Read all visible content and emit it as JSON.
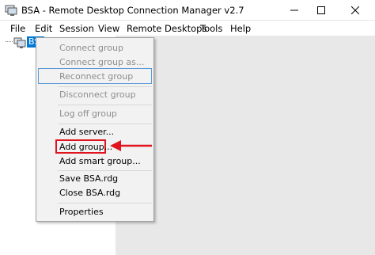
{
  "window": {
    "title": "BSA - Remote Desktop Connection Manager v2.7",
    "minimize_icon": "minimize-icon",
    "maximize_icon": "maximize-icon",
    "close_icon": "close-icon"
  },
  "menubar": {
    "items": [
      "File",
      "Edit",
      "Session",
      "View",
      "Remote Desktops",
      "Tools",
      "Help"
    ]
  },
  "tree": {
    "root_label": "BSA",
    "root_icon": "server-group-icon"
  },
  "context_menu": {
    "items": [
      {
        "label": "Connect group",
        "enabled": false
      },
      {
        "label": "Connect group as...",
        "enabled": false
      },
      {
        "label": "Reconnect group",
        "enabled": false
      },
      {
        "label": "Disconnect group",
        "enabled": false
      },
      {
        "label": "Log off group",
        "enabled": false
      },
      {
        "label": "Add server...",
        "enabled": true
      },
      {
        "label": "Add group...",
        "enabled": true
      },
      {
        "label": "Add smart group...",
        "enabled": true
      },
      {
        "label": "Save BSA.rdg",
        "enabled": true
      },
      {
        "label": "Close BSA.rdg",
        "enabled": true
      },
      {
        "label": "Properties",
        "enabled": true
      }
    ]
  },
  "colors": {
    "selection": "#0078d7",
    "annotation": "#e0141e",
    "menu_background": "#f2f2f2",
    "workspace": "#e8e8e8"
  }
}
